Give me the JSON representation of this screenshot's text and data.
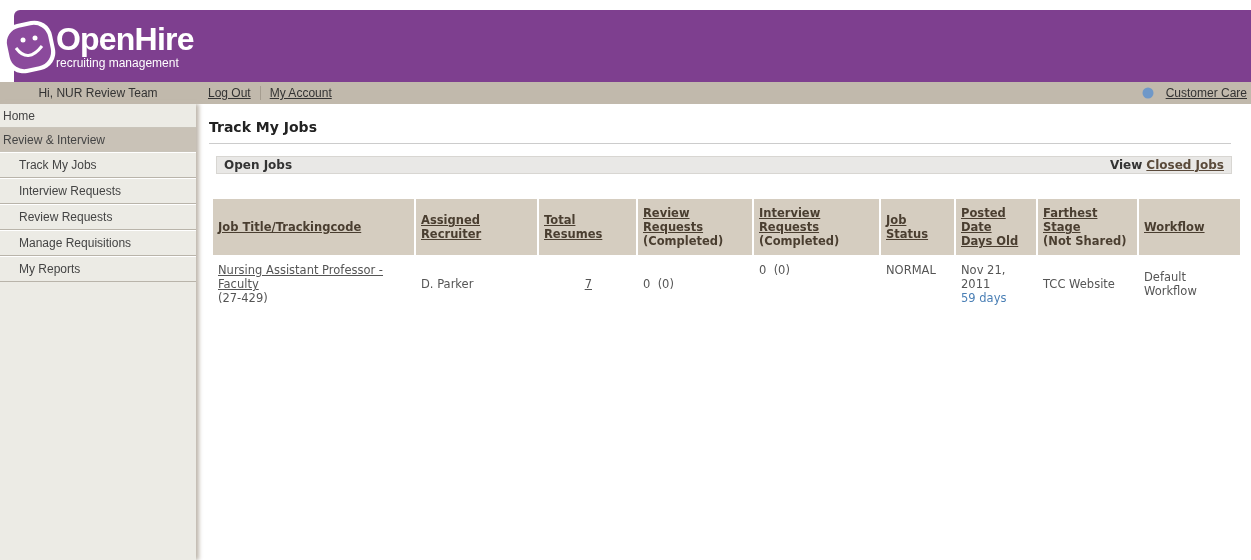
{
  "header": {
    "logo_title": "OpenHire",
    "logo_subtitle": "recruiting management"
  },
  "top_bar": {
    "greeting": "Hi, NUR Review Team",
    "links": [
      "Log Out",
      "My Account"
    ],
    "help_link": "Customer Care"
  },
  "sidebar": {
    "items": [
      {
        "label": "Home",
        "selected": false
      },
      {
        "label": "Review & Interview",
        "selected": true,
        "children": [
          {
            "label": "Track My Jobs",
            "selected": false
          },
          {
            "label": "Interview Requests",
            "selected": false
          },
          {
            "label": "Review Requests",
            "selected": false
          },
          {
            "label": "Manage Requisitions",
            "selected": false
          },
          {
            "label": "My Reports",
            "selected": false
          }
        ]
      }
    ]
  },
  "page_title": "Track My Jobs",
  "jobs_bar": {
    "title": "Open Jobs",
    "view_label": "View",
    "view_link": "Closed Jobs"
  },
  "table": {
    "columns": [
      {
        "label": [
          "Job Title/Trackingcode"
        ]
      },
      {
        "label": [
          "Assigned",
          "Recruiter"
        ]
      },
      {
        "label": [
          "Total",
          "Resumes"
        ]
      },
      {
        "label": [
          "Review",
          "Requests"
        ],
        "note": "(Completed)"
      },
      {
        "label": [
          "Interview",
          "Requests"
        ],
        "note": "(Completed)"
      },
      {
        "label": [
          "Job",
          "Status"
        ]
      },
      {
        "label": [
          "Posted",
          "Date",
          "Days Old"
        ]
      },
      {
        "label": [
          "Farthest",
          "Stage"
        ],
        "note": "(Not Shared)"
      },
      {
        "label": [
          "Workflow"
        ]
      }
    ],
    "rows": [
      {
        "cells": [
          {
            "kind": "title",
            "text": "Nursing Assistant Professor - Faculty",
            "sub": "(27-429)"
          },
          {
            "kind": "text",
            "text": "D. Parker"
          },
          {
            "kind": "count",
            "text": "7"
          },
          {
            "kind": "text",
            "text": "0  (0)"
          },
          {
            "kind": "top",
            "text": "0  (0)"
          },
          {
            "kind": "top",
            "text": "NORMAL"
          },
          {
            "kind": "date",
            "text": "Nov 21, 2011",
            "sub": "59 days"
          },
          {
            "kind": "text",
            "text": "TCC Website"
          },
          {
            "kind": "text",
            "text": "Default Workflow"
          }
        ]
      }
    ]
  }
}
